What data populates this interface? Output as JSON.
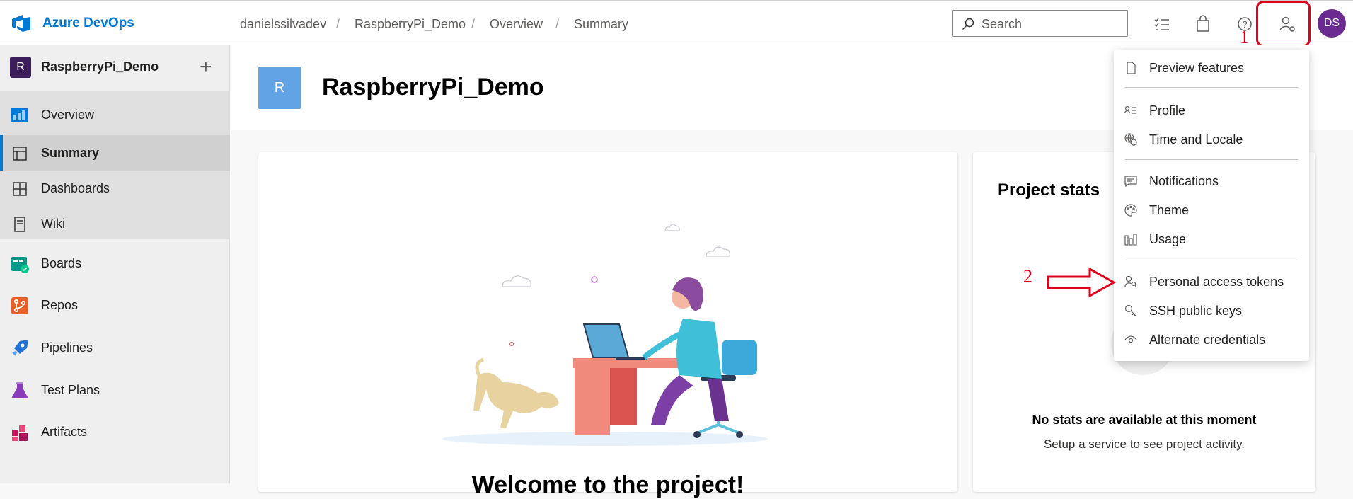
{
  "topbar": {
    "brand": "Azure DevOps",
    "breadcrumbs": [
      "danielssilvadev",
      "RaspberryPi_Demo",
      "Overview",
      "Summary"
    ],
    "separator": "/",
    "search_placeholder": "Search",
    "avatar_initials": "DS"
  },
  "sidebar": {
    "project_initial": "R",
    "project_name": "RaspberryPi_Demo",
    "add_symbol": "+",
    "items": [
      {
        "label": "Overview"
      },
      {
        "label": "Summary"
      },
      {
        "label": "Dashboards"
      },
      {
        "label": "Wiki"
      },
      {
        "label": "Boards"
      },
      {
        "label": "Repos"
      },
      {
        "label": "Pipelines"
      },
      {
        "label": "Test Plans"
      },
      {
        "label": "Artifacts"
      }
    ]
  },
  "main": {
    "project_initial": "R",
    "title": "RaspberryPi_Demo",
    "welcome": "Welcome to the project!",
    "stats_title": "Project stats",
    "no_stats": "No stats are available at this moment",
    "no_stats_sub": "Setup a service to see project activity."
  },
  "menu": {
    "items": [
      {
        "label": "Preview features",
        "icon": "page-icon"
      },
      {
        "label": "Profile",
        "icon": "profile-card-icon"
      },
      {
        "label": "Time and Locale",
        "icon": "globe-clock-icon"
      },
      {
        "label": "Notifications",
        "icon": "comment-icon"
      },
      {
        "label": "Theme",
        "icon": "palette-icon"
      },
      {
        "label": "Usage",
        "icon": "bar-chart-icon"
      },
      {
        "label": "Personal access tokens",
        "icon": "user-key-icon"
      },
      {
        "label": "SSH public keys",
        "icon": "key-icon"
      },
      {
        "label": "Alternate credentials",
        "icon": "eye-icon"
      }
    ]
  },
  "annotations": {
    "step1": "1",
    "step2": "2",
    "color": "#e0001b"
  },
  "colors": {
    "accent": "#0078d4",
    "avatar": "#6b2a8f",
    "project_tile": "#62a3e6"
  }
}
